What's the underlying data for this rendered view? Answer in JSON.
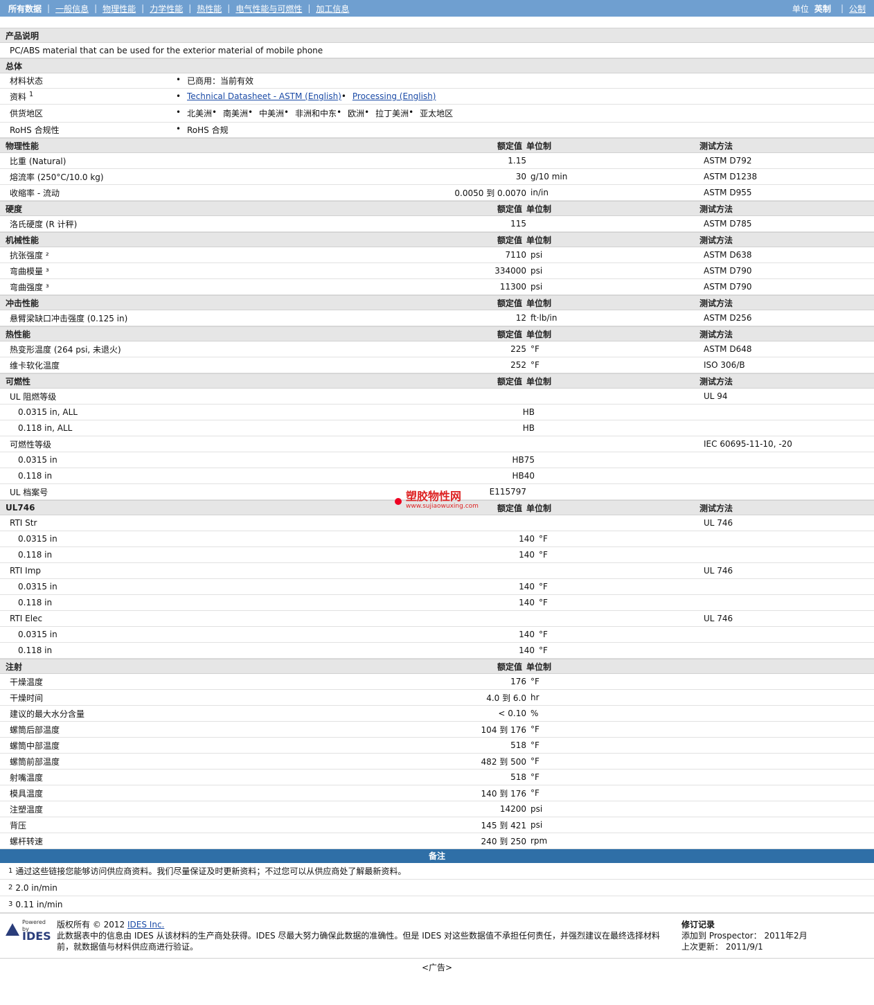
{
  "nav": {
    "all_data": "所有数据",
    "items": [
      "一般信息",
      "物理性能",
      "力学性能",
      "热性能",
      "电气性能与可燃性",
      "加工信息"
    ],
    "units_label": "单位",
    "english": "英制",
    "metric": "公制"
  },
  "product": {
    "head": "产品说明",
    "desc": "PC/ABS material that can be used for the exterior material of mobile phone"
  },
  "general": {
    "head": "总体",
    "status_label": "材料状态",
    "status_value": "已商用：当前有效",
    "docs_label": "资料",
    "docs_sup": "1",
    "docs": [
      "Technical Datasheet - ASTM (English)",
      "Processing (English)"
    ],
    "regions_label": "供货地区",
    "regions": [
      "北美洲",
      "南美洲",
      "中美洲",
      "非洲和中东",
      "欧洲",
      "拉丁美洲",
      "亚太地区"
    ],
    "rohs_label": "RoHS 合规性",
    "rohs_value": "RoHS 合规"
  },
  "table_headers": {
    "rated": "额定值",
    "unit": "单位制",
    "test": "测试方法"
  },
  "physical": {
    "head": "物理性能",
    "rows": [
      {
        "name": "比重 (Natural)",
        "value": "1.15",
        "unit": "",
        "test": "ASTM D792"
      },
      {
        "name": "熔流率 (250°C/10.0 kg)",
        "value": "30",
        "unit": "g/10 min",
        "test": "ASTM D1238"
      },
      {
        "name": "收缩率 - 流动",
        "value": "0.0050 到 0.0070",
        "unit": "in/in",
        "test": "ASTM D955"
      }
    ]
  },
  "hardness": {
    "head": "硬度",
    "rows": [
      {
        "name": "洛氏硬度 (R 计秤)",
        "value": "115",
        "unit": "",
        "test": "ASTM D785"
      }
    ]
  },
  "mechanical": {
    "head": "机械性能",
    "rows": [
      {
        "name": "抗张强度 ²",
        "value": "7110",
        "unit": "psi",
        "test": "ASTM D638"
      },
      {
        "name": "弯曲模量 ³",
        "value": "334000",
        "unit": "psi",
        "test": "ASTM D790"
      },
      {
        "name": "弯曲强度 ³",
        "value": "11300",
        "unit": "psi",
        "test": "ASTM D790"
      }
    ]
  },
  "impact": {
    "head": "冲击性能",
    "rows": [
      {
        "name": "悬臂梁缺口冲击强度 (0.125 in)",
        "value": "12",
        "unit": "ft·lb/in",
        "test": "ASTM D256"
      }
    ]
  },
  "thermal": {
    "head": "热性能",
    "rows": [
      {
        "name": "热变形温度 (264 psi, 未退火)",
        "value": "225",
        "unit": "°F",
        "test": "ASTM D648"
      },
      {
        "name": "维卡软化温度",
        "value": "252",
        "unit": "°F",
        "test": "ISO 306/B"
      }
    ]
  },
  "flammability": {
    "head": "可燃性",
    "rows": [
      {
        "name": "UL 阻燃等级",
        "value": "",
        "unit": "",
        "test": "UL 94",
        "sub": false
      },
      {
        "name": "0.0315 in, ALL",
        "value": "HB",
        "unit": "",
        "test": "",
        "sub": true
      },
      {
        "name": "0.118 in, ALL",
        "value": "HB",
        "unit": "",
        "test": "",
        "sub": true
      },
      {
        "name": "可燃性等级",
        "value": "",
        "unit": "",
        "test": "IEC 60695-11-10, -20",
        "sub": false
      },
      {
        "name": "0.0315 in",
        "value": "HB75",
        "unit": "",
        "test": "",
        "sub": true
      },
      {
        "name": "0.118 in",
        "value": "HB40",
        "unit": "",
        "test": "",
        "sub": true
      },
      {
        "name": "UL 档案号",
        "value": "E115797",
        "unit": "",
        "test": "",
        "sub": false
      }
    ]
  },
  "ul746": {
    "head": "UL746",
    "rows": [
      {
        "name": "RTI Str",
        "value": "",
        "unit": "",
        "test": "UL 746",
        "sub": false
      },
      {
        "name": "0.0315 in",
        "value": "140",
        "unit": "°F",
        "test": "",
        "sub": true
      },
      {
        "name": "0.118 in",
        "value": "140",
        "unit": "°F",
        "test": "",
        "sub": true
      },
      {
        "name": "RTI Imp",
        "value": "",
        "unit": "",
        "test": "UL 746",
        "sub": false
      },
      {
        "name": "0.0315 in",
        "value": "140",
        "unit": "°F",
        "test": "",
        "sub": true
      },
      {
        "name": "0.118 in",
        "value": "140",
        "unit": "°F",
        "test": "",
        "sub": true
      },
      {
        "name": "RTI Elec",
        "value": "",
        "unit": "",
        "test": "UL 746",
        "sub": false
      },
      {
        "name": "0.0315 in",
        "value": "140",
        "unit": "°F",
        "test": "",
        "sub": true
      },
      {
        "name": "0.118 in",
        "value": "140",
        "unit": "°F",
        "test": "",
        "sub": true
      }
    ]
  },
  "injection": {
    "head": "注射",
    "rows": [
      {
        "name": "干燥温度",
        "value": "176",
        "unit": "°F",
        "test": ""
      },
      {
        "name": "干燥时间",
        "value": "4.0 到 6.0",
        "unit": "hr",
        "test": ""
      },
      {
        "name": "建议的最大水分含量",
        "value": "< 0.10",
        "unit": "%",
        "test": ""
      },
      {
        "name": "螺筒后部温度",
        "value": "104 到 176",
        "unit": "°F",
        "test": ""
      },
      {
        "name": "螺筒中部温度",
        "value": "518",
        "unit": "°F",
        "test": ""
      },
      {
        "name": "螺筒前部温度",
        "value": "482 到 500",
        "unit": "°F",
        "test": ""
      },
      {
        "name": "射嘴温度",
        "value": "518",
        "unit": "°F",
        "test": ""
      },
      {
        "name": "模具温度",
        "value": "140 到 176",
        "unit": "°F",
        "test": ""
      },
      {
        "name": "注塑温度",
        "value": "14200",
        "unit": "psi",
        "test": ""
      },
      {
        "name": "背压",
        "value": "145 到 421",
        "unit": "psi",
        "test": ""
      },
      {
        "name": "螺杆转速",
        "value": "240 到 250",
        "unit": "rpm",
        "test": ""
      }
    ]
  },
  "notes": {
    "head": "备注",
    "items": [
      {
        "sup": "1",
        "text": "通过这些链接您能够访问供应商资料。我们尽量保证及时更新资料；不过您可以从供应商处了解最新资料。"
      },
      {
        "sup": "2",
        "text": "2.0 in/min"
      },
      {
        "sup": "3",
        "text": "0.11 in/min"
      }
    ]
  },
  "footer": {
    "powered_by": "Powered by",
    "logo_text": "IDES",
    "copyright_prefix": "版权所有 © 2012",
    "copyright_link": "IDES Inc.",
    "disclaimer": "此数据表中的信息由 IDES 从该材料的生产商处获得。IDES 尽最大努力确保此数据的准确性。但是 IDES 对这些数据值不承担任何责任，并强烈建议在最终选择材料前，就数据值与材料供应商进行验证。",
    "rev_title": "修订记录",
    "added_label": "添加到 Prospector：",
    "added_value": "2011年2月",
    "updated_label": "上次更新：",
    "updated_value": "2011/9/1"
  },
  "ad": "<广告>",
  "watermark": {
    "title": "塑胶物性网",
    "url": "www.sujiaowuxing.com"
  }
}
